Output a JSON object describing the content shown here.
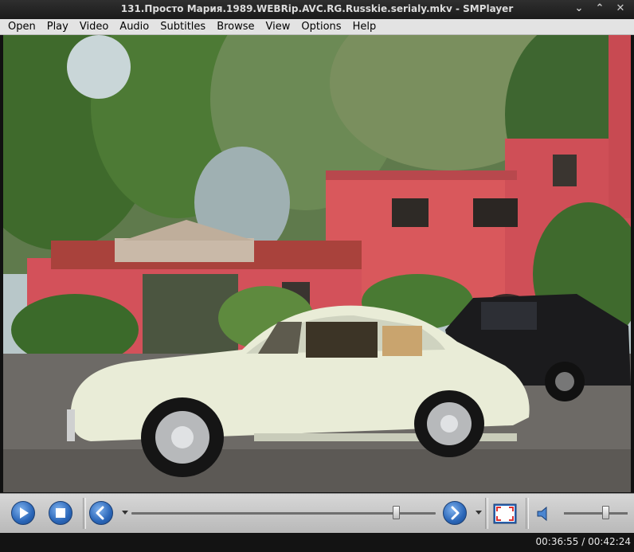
{
  "window": {
    "title": "131.Просто Мария.1989.WEBRip.AVC.RG.Russkie.serialy.mkv - SMPlayer",
    "controls": {
      "minimize_glyph": "⌄",
      "restore_glyph": "⌃",
      "close_glyph": "✕"
    }
  },
  "menu": {
    "items": [
      {
        "label": "Open"
      },
      {
        "label": "Play"
      },
      {
        "label": "Video"
      },
      {
        "label": "Audio"
      },
      {
        "label": "Subtitles"
      },
      {
        "label": "Browse"
      },
      {
        "label": "View"
      },
      {
        "label": "Options"
      },
      {
        "label": "Help"
      }
    ]
  },
  "video": {
    "scene": "a pale cream classic car parked in a driveway in front of a pink house with trees, a black car to the right"
  },
  "controls": {
    "icons": [
      "play-icon",
      "stop-icon",
      "rewind-icon",
      "forward-icon",
      "fullscreen-icon",
      "speaker-icon"
    ],
    "accent_color": "#2a66b8",
    "seek_fraction": 0.869,
    "volume_fraction": 0.65
  },
  "status": {
    "current_time": "00:36:55",
    "separator": " / ",
    "total_time": "00:42:24"
  }
}
